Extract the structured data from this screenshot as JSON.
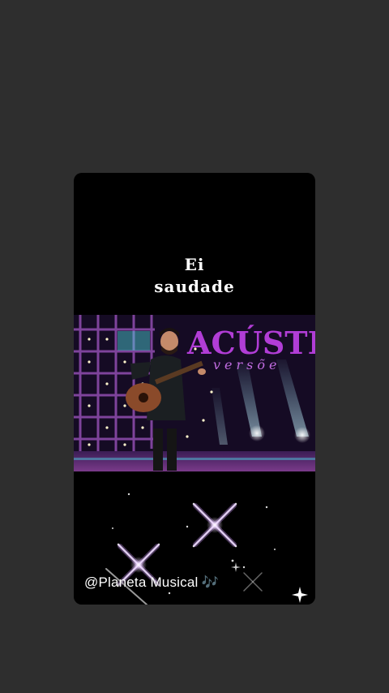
{
  "lyric": {
    "line1": "Ei",
    "line2": "saudade"
  },
  "video": {
    "banner_text": "ACÚSTIC",
    "banner_sub": "versõe"
  },
  "credit": {
    "handle": "@Planeta Musical",
    "emoji": "🎶"
  },
  "colors": {
    "background": "#2e2e2e",
    "card": "#000000",
    "banner": "#b13dd6",
    "note": "#b28cf0"
  }
}
